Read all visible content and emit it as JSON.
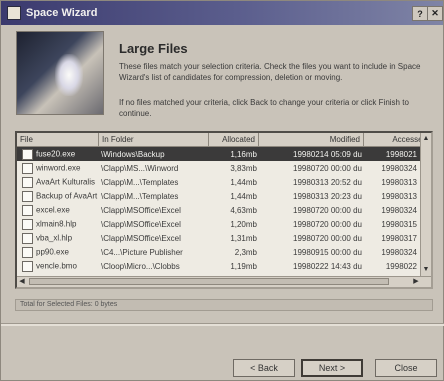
{
  "window": {
    "title": "Space Wizard",
    "close_glyph": "✕",
    "help_glyph": "?"
  },
  "header": {
    "title": "Large Files",
    "paragraph1": "These files match your selection criteria. Check the files you want to include in Space Wizard's list of candidates for compression, deletion or moving.",
    "paragraph2": "If no files matched your criteria, click Back to change your criteria or click Finish to continue."
  },
  "list": {
    "columns": [
      "File",
      "In Folder",
      "Allocated",
      "Modified",
      "Accessed"
    ],
    "rows": [
      {
        "file": "fuse20.exe",
        "folder": "\\Windows\\Backup",
        "allocated": "1,16mb",
        "modified": "19980214 05:09 du",
        "accessed": "1998021",
        "selected": true
      },
      {
        "file": "winword.exe",
        "folder": "\\Clapp\\MS...\\Winword",
        "allocated": "3,83mb",
        "modified": "19980720 00:00 du",
        "accessed": "19980324",
        "selected": false
      },
      {
        "file": "AvaArt Kulturalis",
        "folder": "\\Clapp\\M...\\Templates",
        "allocated": "1,44mb",
        "modified": "19980313 20:52 du",
        "accessed": "19980313",
        "selected": false
      },
      {
        "file": "Backup of AvaArt",
        "folder": "\\Clapp\\M...\\Templates",
        "allocated": "1,44mb",
        "modified": "19980313 20:23 du",
        "accessed": "19980313",
        "selected": false
      },
      {
        "file": "excel.exe",
        "folder": "\\Clapp\\MSOffice\\Excel",
        "allocated": "4,63mb",
        "modified": "19980720 00:00 du",
        "accessed": "19980324",
        "selected": false
      },
      {
        "file": "xlmain8.hlp",
        "folder": "\\Clapp\\MSOffice\\Excel",
        "allocated": "1,20mb",
        "modified": "19980720 00:00 du",
        "accessed": "19980315",
        "selected": false
      },
      {
        "file": "vba_xl.hlp",
        "folder": "\\Clapp\\MSOffice\\Excel",
        "allocated": "1,31mb",
        "modified": "19980720 00:00 du",
        "accessed": "19980317",
        "selected": false
      },
      {
        "file": "pp90.exe",
        "folder": "\\C4...\\Picture Publisher",
        "allocated": "2,3mb",
        "modified": "19980915 00:00 du",
        "accessed": "19980324",
        "selected": false
      },
      {
        "file": "vencle.bmo",
        "folder": "\\Cloop\\Micro...\\Clobbs",
        "allocated": "1,19mb",
        "modified": "19980222 14:43 du",
        "accessed": "1998022",
        "selected": false
      }
    ]
  },
  "total_bar": "Total for Selected Files: 0 bytes",
  "buttons": {
    "back": "< Back",
    "next": "Next >",
    "close": "Close"
  }
}
